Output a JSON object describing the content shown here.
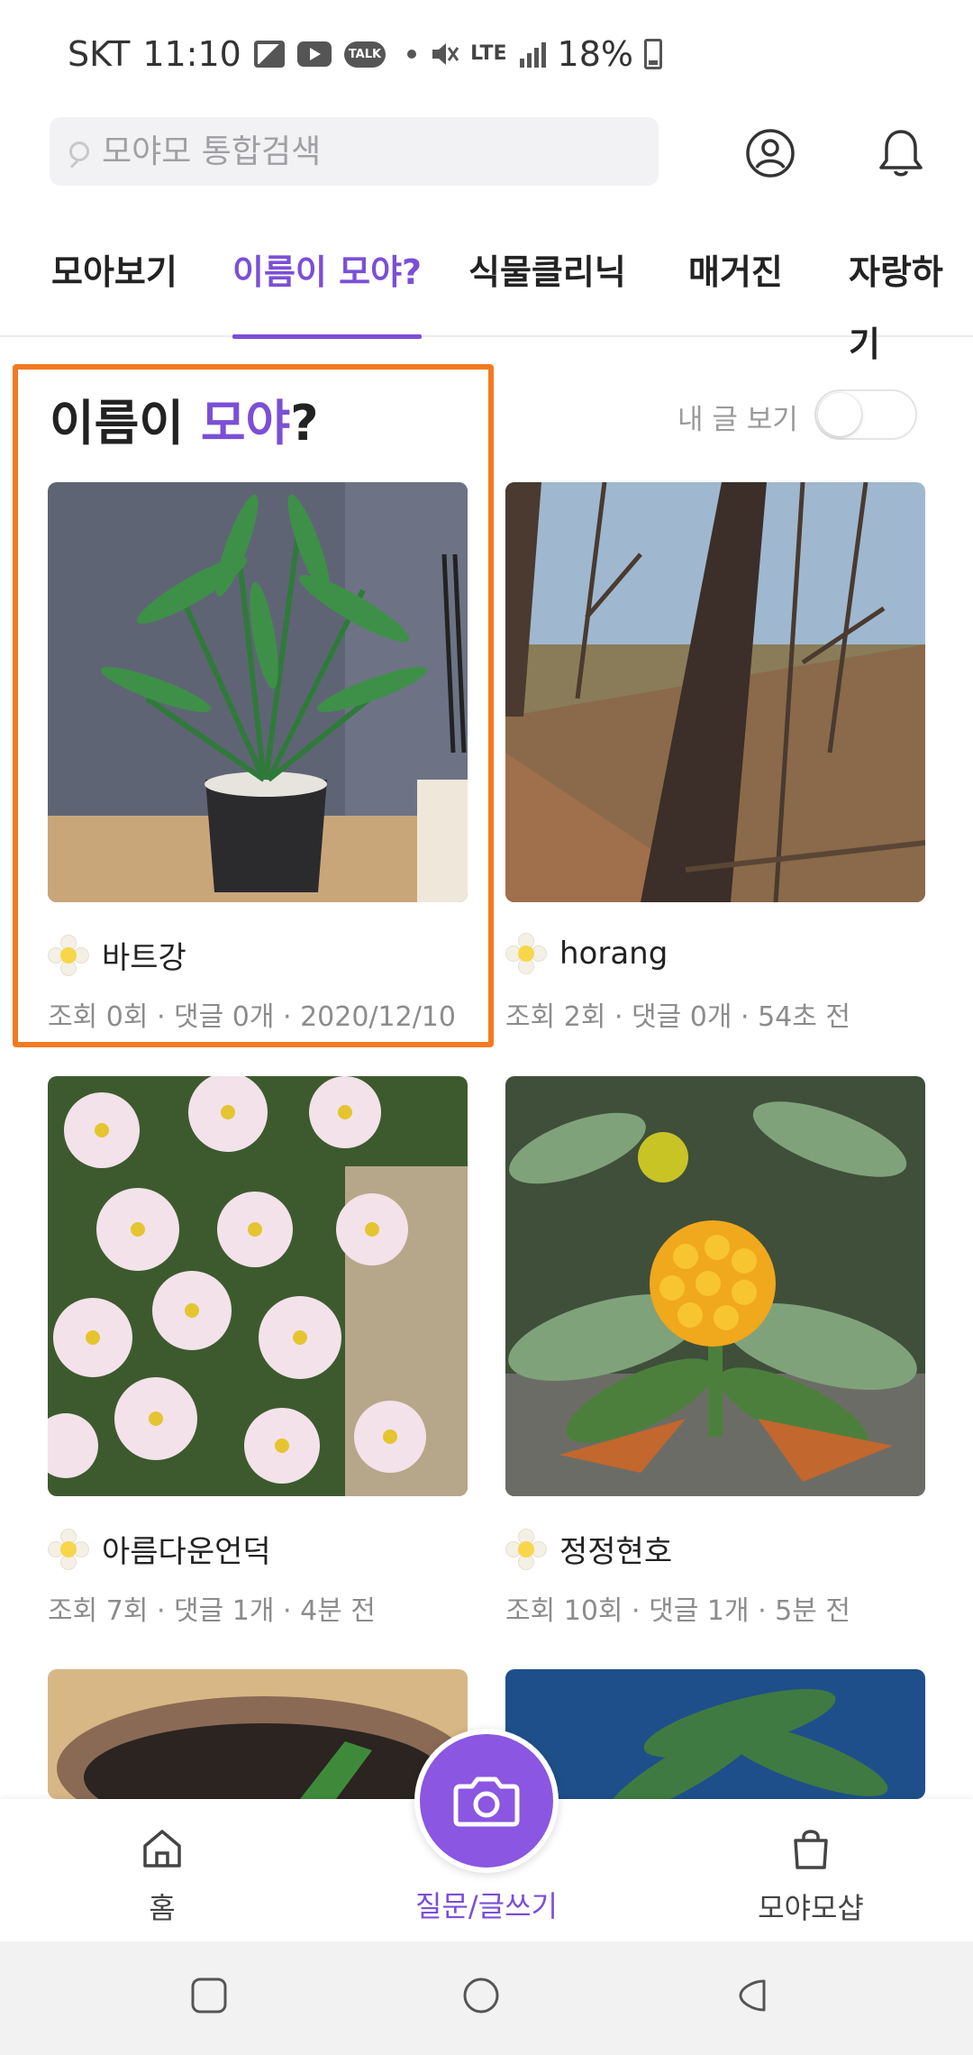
{
  "status_bar": {
    "carrier": "SKT",
    "time": "11:10",
    "talk_badge": "TALK",
    "network": "LTE",
    "battery": "18%"
  },
  "search": {
    "placeholder": "모야모 통합검색"
  },
  "tabs": [
    {
      "label": "모아보기",
      "active": false
    },
    {
      "label": "이름이 모야?",
      "active": true
    },
    {
      "label": "식물클리닉",
      "active": false
    },
    {
      "label": "매거진",
      "active": false
    },
    {
      "label": "자랑하기",
      "active": false
    }
  ],
  "section": {
    "title_prefix": "이름이 ",
    "title_accent": "모야",
    "title_suffix": "?",
    "my_posts_label": "내 글 보기",
    "my_posts_toggle_on": false
  },
  "posts": [
    {
      "author": "바트강",
      "meta": "조회 0회 · 댓글 0개 · 2020/12/10"
    },
    {
      "author": "horang",
      "meta": "조회 2회 · 댓글 0개 · 54초 전"
    },
    {
      "author": "아름다운언덕",
      "meta": "조회 7회 · 댓글 1개 · 4분 전"
    },
    {
      "author": "정정현호",
      "meta": "조회 10회 · 댓글 1개 · 5분 전"
    }
  ],
  "bottom_nav": {
    "home": "홈",
    "write": "질문/글쓰기",
    "shop": "모야모샵"
  },
  "colors": {
    "accent": "#7b4fd6",
    "highlight": "#f37a20",
    "camera_button": "#8a56e2"
  }
}
